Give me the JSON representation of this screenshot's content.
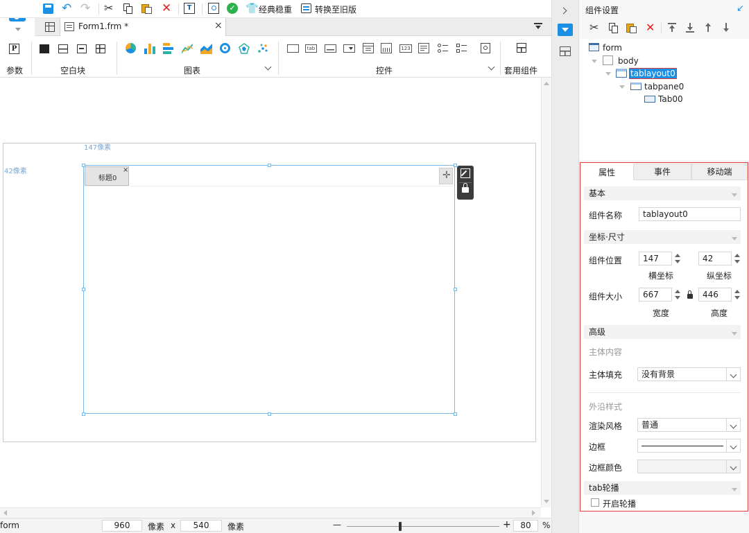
{
  "toolbar": {
    "classic_label": "经典稳重",
    "convert_label": "转换至旧版"
  },
  "tab": {
    "filename": "Form1.frm *",
    "close": "×"
  },
  "ribbon": {
    "groups": [
      "参数",
      "空白块",
      "图表",
      "控件",
      "套用组件"
    ],
    "param_icon": "P",
    "tab_ctl": "tab",
    "num_ctl": "123"
  },
  "canvas": {
    "x_hint": "147像素",
    "y_hint": "42像素",
    "tab_title": "标题0",
    "tab_close": "×"
  },
  "statusbar": {
    "component": "form",
    "width": "960",
    "unit1": "像素",
    "times": "x",
    "height": "540",
    "unit2": "像素",
    "minus": "—",
    "plus": "+",
    "zoom": "80",
    "percent": "%"
  },
  "panel": {
    "title": "组件设置",
    "tree": [
      "form",
      "body",
      "tablayout0",
      "tabpane0",
      "Tab00"
    ]
  },
  "props": {
    "tabs": [
      "属性",
      "事件",
      "移动端"
    ],
    "basic": "基本",
    "name_label": "组件名称",
    "name_value": "tablayout0",
    "coord_section": "坐标·尺寸",
    "pos_label": "组件位置",
    "x_value": "147",
    "y_value": "42",
    "x_caption": "横坐标",
    "y_caption": "纵坐标",
    "size_label": "组件大小",
    "w_value": "667",
    "h_value": "446",
    "w_caption": "宽度",
    "h_caption": "高度",
    "advanced": "高级",
    "body_content": "主体内容",
    "fill_label": "主体填充",
    "fill_value": "没有背景",
    "outer_style": "外沿样式",
    "render_label": "渲染风格",
    "render_value": "普通",
    "border_label": "边框",
    "border_color_label": "边框颜色",
    "carousel_section": "tab轮播",
    "carousel_label": "开启轮播"
  },
  "colors": {
    "accent": "#1a8fe3",
    "selection_border": "#e03a3a",
    "layout_border": "#78b7e6"
  }
}
